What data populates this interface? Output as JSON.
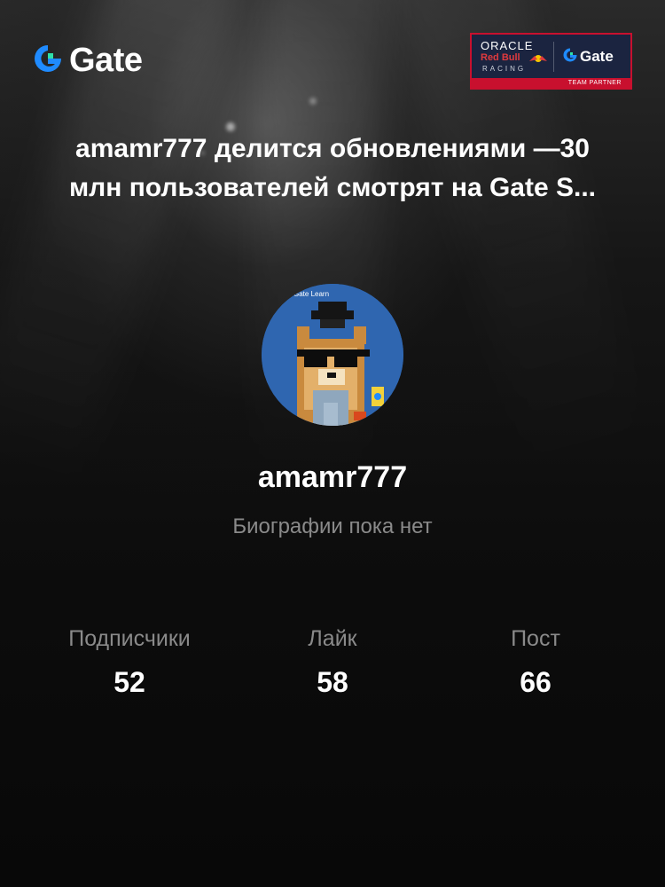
{
  "brand": {
    "logo_text": "Gate",
    "logo_icon": "gate-logo-icon",
    "accent_color": "#1f8bff"
  },
  "partner_badge": {
    "oracle": "ORACLE",
    "red_bull": "Red Bull",
    "racing": "RACING",
    "gate": "Gate",
    "footer": "TEAM PARTNER"
  },
  "headline": "amamr777 делится обновлениями —30 млн пользователей смотрят на Gate S...",
  "profile": {
    "avatar_caption": "Gate Learn",
    "username": "amamr777",
    "bio": "Биографии пока нет"
  },
  "stats": [
    {
      "label": "Подписчики",
      "value": "52"
    },
    {
      "label": "Лайк",
      "value": "58"
    },
    {
      "label": "Пост",
      "value": "66"
    }
  ]
}
